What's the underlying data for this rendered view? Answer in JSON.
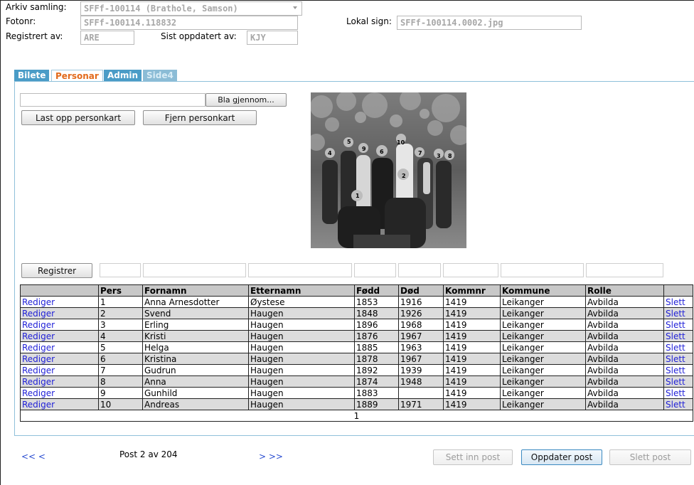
{
  "header": {
    "arkiv_label": "Arkiv samling:",
    "arkiv_value": "SFFf-100114 (Brathole, Samson)",
    "fotonr_label": "Fotonr:",
    "fotonr_value": "SFFf-100114.118832",
    "lokal_label": "Lokal sign:",
    "lokal_value": "SFFf-100114.0002.jpg",
    "reg_label": "Registrert av:",
    "reg_value": "ARE",
    "upd_label": "Sist oppdatert av:",
    "upd_value": "KJY"
  },
  "tabs": [
    "Bilete",
    "Personar",
    "Admin",
    "Side4"
  ],
  "upload": {
    "browse_label": "Bla gjennom...",
    "upload_label": "Last opp personkart",
    "remove_label": "Fjern personkart",
    "register_label": "Registrer"
  },
  "table": {
    "columns": [
      "",
      "Pers",
      "Fornamn",
      "Etternamn",
      "Fødd",
      "Død",
      "Kommnr",
      "Kommune",
      "Rolle",
      ""
    ],
    "edit_label": "Rediger",
    "delete_label": "Slett",
    "rows": [
      {
        "pers": "1",
        "fornamn": "Anna Arnesdotter",
        "etternamn": "Øystese",
        "fodd": "1853",
        "dod": "1916",
        "kommnr": "1419",
        "kommune": "Leikanger",
        "rolle": "Avbilda"
      },
      {
        "pers": "2",
        "fornamn": "Svend",
        "etternamn": "Haugen",
        "fodd": "1848",
        "dod": "1926",
        "kommnr": "1419",
        "kommune": "Leikanger",
        "rolle": "Avbilda"
      },
      {
        "pers": "3",
        "fornamn": "Erling",
        "etternamn": "Haugen",
        "fodd": "1896",
        "dod": "1968",
        "kommnr": "1419",
        "kommune": "Leikanger",
        "rolle": "Avbilda"
      },
      {
        "pers": "4",
        "fornamn": "Kristi",
        "etternamn": "Haugen",
        "fodd": "1876",
        "dod": "1967",
        "kommnr": "1419",
        "kommune": "Leikanger",
        "rolle": "Avbilda"
      },
      {
        "pers": "5",
        "fornamn": "Helga",
        "etternamn": "Haugen",
        "fodd": "1885",
        "dod": "1963",
        "kommnr": "1419",
        "kommune": "Leikanger",
        "rolle": "Avbilda"
      },
      {
        "pers": "6",
        "fornamn": "Kristina",
        "etternamn": "Haugen",
        "fodd": "1878",
        "dod": "1967",
        "kommnr": "1419",
        "kommune": "Leikanger",
        "rolle": "Avbilda"
      },
      {
        "pers": "7",
        "fornamn": "Gudrun",
        "etternamn": "Haugen",
        "fodd": "1892",
        "dod": "1939",
        "kommnr": "1419",
        "kommune": "Leikanger",
        "rolle": "Avbilda"
      },
      {
        "pers": "8",
        "fornamn": "Anna",
        "etternamn": "Haugen",
        "fodd": "1874",
        "dod": "1948",
        "kommnr": "1419",
        "kommune": "Leikanger",
        "rolle": "Avbilda"
      },
      {
        "pers": "9",
        "fornamn": "Gunhild",
        "etternamn": "Haugen",
        "fodd": "1883",
        "dod": "",
        "kommnr": "1419",
        "kommune": "Leikanger",
        "rolle": "Avbilda"
      },
      {
        "pers": "10",
        "fornamn": "Andreas",
        "etternamn": "Haugen",
        "fodd": "1889",
        "dod": "1971",
        "kommnr": "1419",
        "kommune": "Leikanger",
        "rolle": "Avbilda"
      }
    ],
    "page_number": "1"
  },
  "photo_markers": [
    "1",
    "2",
    "3",
    "4",
    "5",
    "6",
    "7",
    "8",
    "9",
    "10"
  ],
  "footer": {
    "first_prev": "<< <",
    "post_status": "Post 2 av 204",
    "next_last": "> >>",
    "insert_label": "Sett inn post",
    "update_label": "Oppdater post",
    "delete_label": "Slett post"
  },
  "colors": {
    "tab_blue": "#4a9cc7",
    "active_tab_text": "#e26a1c",
    "link": "#1f1fd7"
  }
}
